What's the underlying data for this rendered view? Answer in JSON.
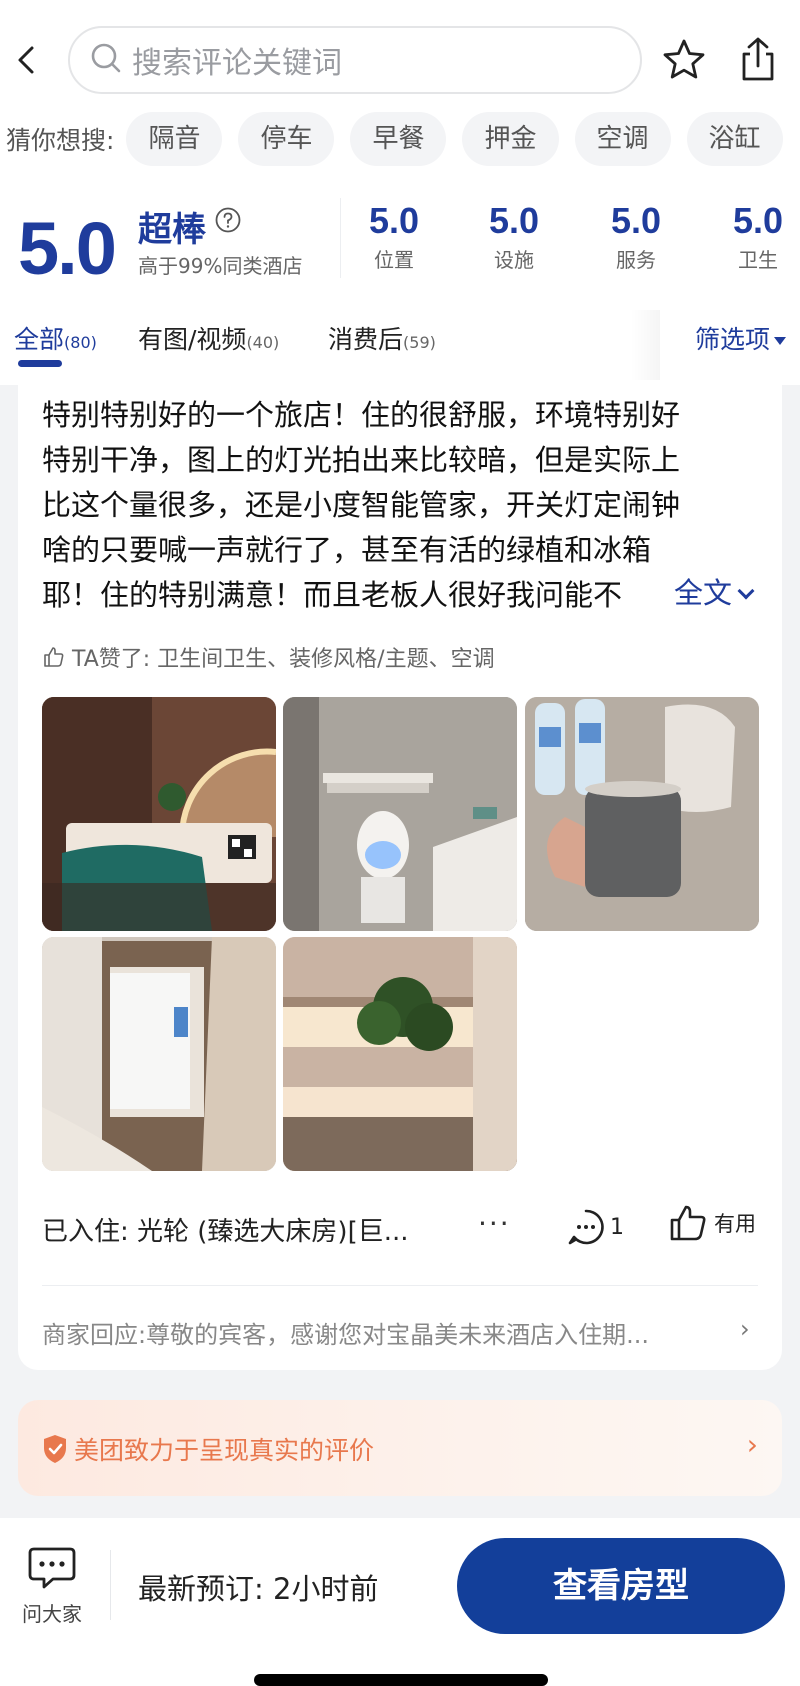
{
  "header": {
    "search_placeholder": "搜索评论关键词",
    "icons": [
      "back-icon",
      "search-icon",
      "star-icon",
      "share-icon"
    ]
  },
  "suggestions": {
    "label": "猜你想搜:",
    "chips": [
      "隔音",
      "停车",
      "早餐",
      "押金",
      "空调",
      "浴缸"
    ]
  },
  "rating": {
    "overall": "5.0",
    "grade": "超棒",
    "percentile": "高于99%同类酒店",
    "subscores": [
      {
        "value": "5.0",
        "label": "位置"
      },
      {
        "value": "5.0",
        "label": "设施"
      },
      {
        "value": "5.0",
        "label": "服务"
      },
      {
        "value": "5.0",
        "label": "卫生"
      }
    ]
  },
  "tabs": {
    "items": [
      {
        "label": "全部",
        "count": "(80)"
      },
      {
        "label": "有图/视频",
        "count": "(40)"
      },
      {
        "label": "消费后",
        "count": "(59)"
      }
    ],
    "filter": "筛选项"
  },
  "review": {
    "lines": [
      "特别特别好的一个旅店！住的很舒服，环境特别好",
      "特别干净，图上的灯光拍出来比较暗，但是实际上",
      "比这个量很多，还是小度智能管家，开关灯定闹钟",
      "啥的只要喊一声就行了，甚至有活的绿植和冰箱",
      "耶！住的特别满意！而且老板人很好我问能不"
    ],
    "full_text_link": "全文",
    "liked": "TA赞了: 卫生间卫生、装修风格/主题、空调",
    "stay": "已入住: 光轮 (臻选大床房)[巨...",
    "more": "···",
    "comment_count": "1",
    "useful": "有用",
    "reply": "商家回应:尊敬的宾客，感谢您对宝晶美未来酒店入住期...",
    "reply_arrow": "›"
  },
  "notice": {
    "text": "美团致力于呈现真实的评价",
    "arrow": "›",
    "color": "#e8784d"
  },
  "bottom_bar": {
    "ask_label": "问大家",
    "latest_booking": "最新预订: 2小时前",
    "cta": "查看房型",
    "cta_color": "#133f9a"
  },
  "accent_color": "#1f3c9c"
}
